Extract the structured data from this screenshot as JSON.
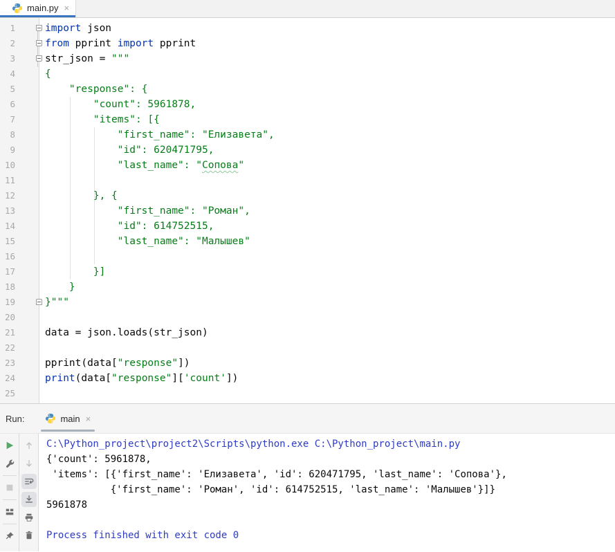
{
  "colors": {
    "editor_tab_underline": "#3b76c0",
    "run_tab_underline": "#a8b0ba",
    "keyword_blue": "#0033b3",
    "string_green": "#067d17",
    "console_system_blue": "#2d3bc4",
    "play_green": "#59a869",
    "gutter_number_gray": "#a8a8a8"
  },
  "editor_tabbar": {
    "tabs": [
      {
        "title": "main.py",
        "icon": "python-icon",
        "close": "×",
        "active": true
      }
    ]
  },
  "editor": {
    "lines": [
      {
        "n": "1",
        "fold": "down",
        "segs": [
          {
            "t": "import",
            "c": "kw"
          },
          {
            "t": " json",
            "c": "plain"
          }
        ]
      },
      {
        "n": "2",
        "fold": "down",
        "segs": [
          {
            "t": "from",
            "c": "kw"
          },
          {
            "t": " pprint ",
            "c": "plain"
          },
          {
            "t": "import",
            "c": "kw"
          },
          {
            "t": " pprint",
            "c": "plain"
          }
        ]
      },
      {
        "n": "3",
        "fold": "down",
        "segs": [
          {
            "t": "str_json = ",
            "c": "plain"
          },
          {
            "t": "\"\"\"",
            "c": "str"
          }
        ]
      },
      {
        "n": "4",
        "segs": [
          {
            "t": "{",
            "c": "str"
          }
        ]
      },
      {
        "n": "5",
        "segs": [
          {
            "t": "    \"response\": {",
            "c": "str"
          }
        ]
      },
      {
        "n": "6",
        "segs": [
          {
            "t": "        \"count\": 5961878,",
            "c": "str"
          }
        ]
      },
      {
        "n": "7",
        "segs": [
          {
            "t": "        \"items\": [{",
            "c": "str"
          }
        ]
      },
      {
        "n": "8",
        "segs": [
          {
            "t": "            \"first_name\": \"Елизавета\",",
            "c": "str"
          }
        ]
      },
      {
        "n": "9",
        "segs": [
          {
            "t": "            \"id\": 620471795,",
            "c": "str"
          }
        ]
      },
      {
        "n": "10",
        "segs": [
          {
            "t": "            \"last_name\": \"",
            "c": "str"
          },
          {
            "t": "Сопова",
            "c": "str typo"
          },
          {
            "t": "\"",
            "c": "str"
          }
        ]
      },
      {
        "n": "11",
        "segs": []
      },
      {
        "n": "12",
        "segs": [
          {
            "t": "        }, {",
            "c": "str"
          }
        ]
      },
      {
        "n": "13",
        "segs": [
          {
            "t": "            \"first_name\": \"Роман\",",
            "c": "str"
          }
        ]
      },
      {
        "n": "14",
        "segs": [
          {
            "t": "            \"id\": 614752515,",
            "c": "str"
          }
        ]
      },
      {
        "n": "15",
        "segs": [
          {
            "t": "            \"last_name\": \"Малышев\"",
            "c": "str"
          }
        ]
      },
      {
        "n": "16",
        "segs": []
      },
      {
        "n": "17",
        "segs": [
          {
            "t": "        }]",
            "c": "str"
          }
        ]
      },
      {
        "n": "18",
        "segs": [
          {
            "t": "    }",
            "c": "str"
          }
        ]
      },
      {
        "n": "19",
        "fold": "up",
        "segs": [
          {
            "t": "}\"\"\"",
            "c": "str"
          }
        ]
      },
      {
        "n": "20",
        "segs": []
      },
      {
        "n": "21",
        "segs": [
          {
            "t": "data = json.loads(str_json)",
            "c": "plain"
          }
        ]
      },
      {
        "n": "22",
        "segs": []
      },
      {
        "n": "23",
        "segs": [
          {
            "t": "pprint(data[",
            "c": "plain"
          },
          {
            "t": "\"response\"",
            "c": "str"
          },
          {
            "t": "])",
            "c": "plain"
          }
        ]
      },
      {
        "n": "24",
        "segs": [
          {
            "t": "print",
            "c": "kw"
          },
          {
            "t": "(data[",
            "c": "plain"
          },
          {
            "t": "\"response\"",
            "c": "str"
          },
          {
            "t": "][",
            "c": "plain"
          },
          {
            "t": "'count'",
            "c": "str"
          },
          {
            "t": "])",
            "c": "plain"
          }
        ]
      },
      {
        "n": "25",
        "segs": []
      }
    ]
  },
  "run_panel": {
    "label": "Run:",
    "tab": {
      "title": "main",
      "icon": "python-icon",
      "close": "×"
    },
    "toolbar_run": [
      {
        "icon": "rerun-icon"
      },
      {
        "icon": "wrench-icon"
      },
      {
        "divider": true
      },
      {
        "icon": "stop-icon",
        "disabled": true
      },
      {
        "divider": true
      },
      {
        "icon": "restore-layout-icon"
      },
      {
        "divider": true
      },
      {
        "icon": "pin-icon"
      }
    ],
    "toolbar_console": [
      {
        "icon": "up-stacktrace-icon",
        "disabled": true
      },
      {
        "icon": "down-stacktrace-icon",
        "disabled": true
      },
      {
        "icon": "soft-wrap-icon",
        "active": true
      },
      {
        "icon": "scroll-to-end-icon",
        "active": true
      },
      {
        "icon": "print-icon"
      },
      {
        "icon": "clear-all-icon"
      }
    ],
    "console_lines": [
      {
        "t": "C:\\Python_project\\project2\\Scripts\\python.exe C:\\Python_project\\main.py",
        "c": "sys"
      },
      {
        "t": "{'count': 5961878,",
        "c": "out"
      },
      {
        "t": " 'items': [{'first_name': 'Елизавета', 'id': 620471795, 'last_name': 'Сопова'},",
        "c": "out"
      },
      {
        "t": "           {'first_name': 'Роман', 'id': 614752515, 'last_name': 'Малышев'}]}",
        "c": "out"
      },
      {
        "t": "5961878",
        "c": "out"
      },
      {
        "t": "",
        "c": "out"
      },
      {
        "t": "Process finished with exit code 0",
        "c": "sys"
      }
    ]
  }
}
